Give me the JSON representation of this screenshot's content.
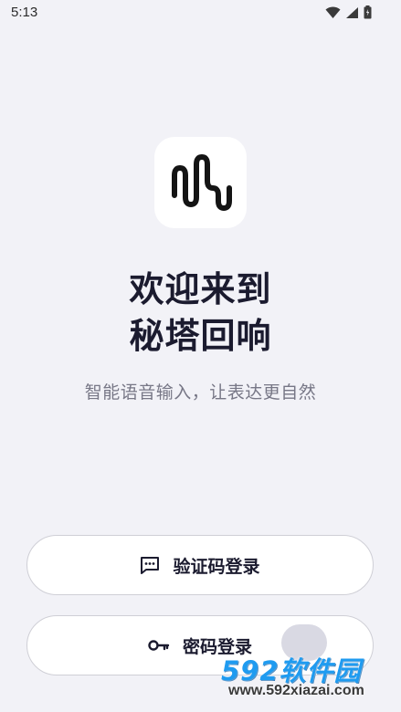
{
  "status_bar": {
    "time": "5:13",
    "icons": [
      "wifi-icon",
      "signal-icon",
      "battery-icon"
    ]
  },
  "app": {
    "logo_icon": "sound-wave-logo",
    "title_line1": "欢迎来到",
    "title_line2": "秘塔回响",
    "subtitle": "智能语音输入，让表达更自然"
  },
  "buttons": {
    "sms_login": {
      "label": "验证码登录",
      "icon": "message-dots-icon"
    },
    "password_login": {
      "label": "密码登录",
      "icon": "key-icon"
    }
  },
  "watermark": {
    "brand": "592软件园",
    "url": "www.592xiazai.com"
  },
  "colors": {
    "background": "#f2f2f7",
    "text_primary": "#1b1b2f",
    "text_secondary": "#777786",
    "button_bg": "#ffffff",
    "button_border": "#cfcfd6",
    "watermark_blue": "#1f9bf0"
  }
}
